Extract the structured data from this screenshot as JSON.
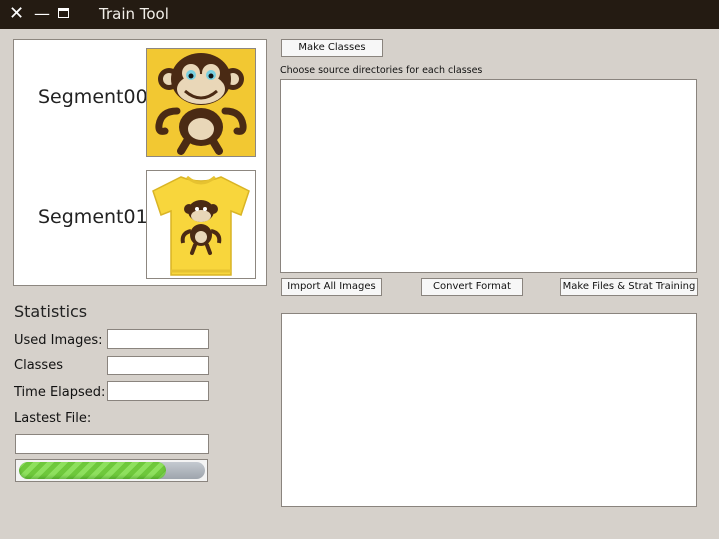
{
  "window": {
    "title": "Train Tool",
    "controls": [
      "close-icon",
      "minimize-icon",
      "maximize-icon"
    ]
  },
  "segments": [
    {
      "label": "Segment00",
      "image": "monkey-cartoon"
    },
    {
      "label": "Segment01",
      "image": "yellow-tshirt-monkey"
    }
  ],
  "stats": {
    "title": "Statistics",
    "used_images_label": "Used Images:",
    "used_images_value": "",
    "classes_label": "Classes",
    "classes_value": "",
    "time_elapsed_label": "Time Elapsed:",
    "time_elapsed_value": "",
    "latest_file_label": "Lastest File:",
    "latest_file_value": "",
    "progress": 0.79
  },
  "toolbar": {
    "make_classes": "Make Classes",
    "import_all": "Import All Images",
    "convert_format": "Convert Format",
    "make_files": "Make Files & Strat Training"
  },
  "source_dirs": {
    "caption": "Choose source directories for each classes"
  },
  "colors": {
    "titlebar": "#241b12",
    "background": "#d6d1cb",
    "progress_green": "#7fd44c"
  }
}
